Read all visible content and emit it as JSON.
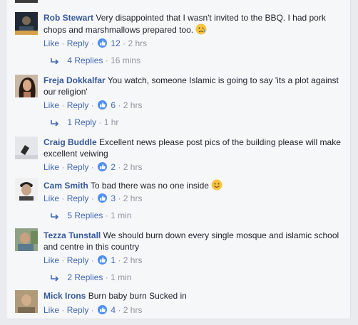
{
  "colors": {
    "link": "#365899",
    "action": "#4267b2",
    "meta": "#90949c",
    "like": "#4e8ff7"
  },
  "action_labels": {
    "like": "Like",
    "reply": "Reply",
    "sep": "·"
  },
  "comments": [
    {
      "name": "Rob Stewart",
      "text": "Very disappointed that I wasn't invited to the BBQ. I had pork chops and marshmallows prepared too.",
      "emoji": "sad-face-emoji",
      "likes": "12",
      "time": "2 hrs",
      "replies": "4 Replies",
      "replies_time": "16 mins"
    },
    {
      "name": "Freja Dokkalfar",
      "text": "You watch, someone Islamic is going to say 'its a plot against our religion'",
      "likes": "6",
      "time": "2 hrs",
      "replies": "1 Reply",
      "replies_time": "1 hr"
    },
    {
      "name": "Craig Buddle",
      "text": "Excellent news please post pics of the building please will make excellent veiwing",
      "likes": "2",
      "time": "2 hrs"
    },
    {
      "name": "Cam Smith",
      "text": "To bad there was no one inside",
      "emoji": "smile-emoji",
      "likes": "3",
      "time": "2 hrs",
      "replies": "5 Replies",
      "replies_time": "1 min"
    },
    {
      "name": "Tezza Tunstall",
      "text": "We should burn down every single mosque and islamic school and centre in this country",
      "likes": "1",
      "time": "2 hrs",
      "replies": "2 Replies",
      "replies_time": "1 min"
    },
    {
      "name": "Mick Irons",
      "text": "Burn baby burn Sucked in",
      "likes": "4",
      "time": "2 hrs"
    }
  ]
}
